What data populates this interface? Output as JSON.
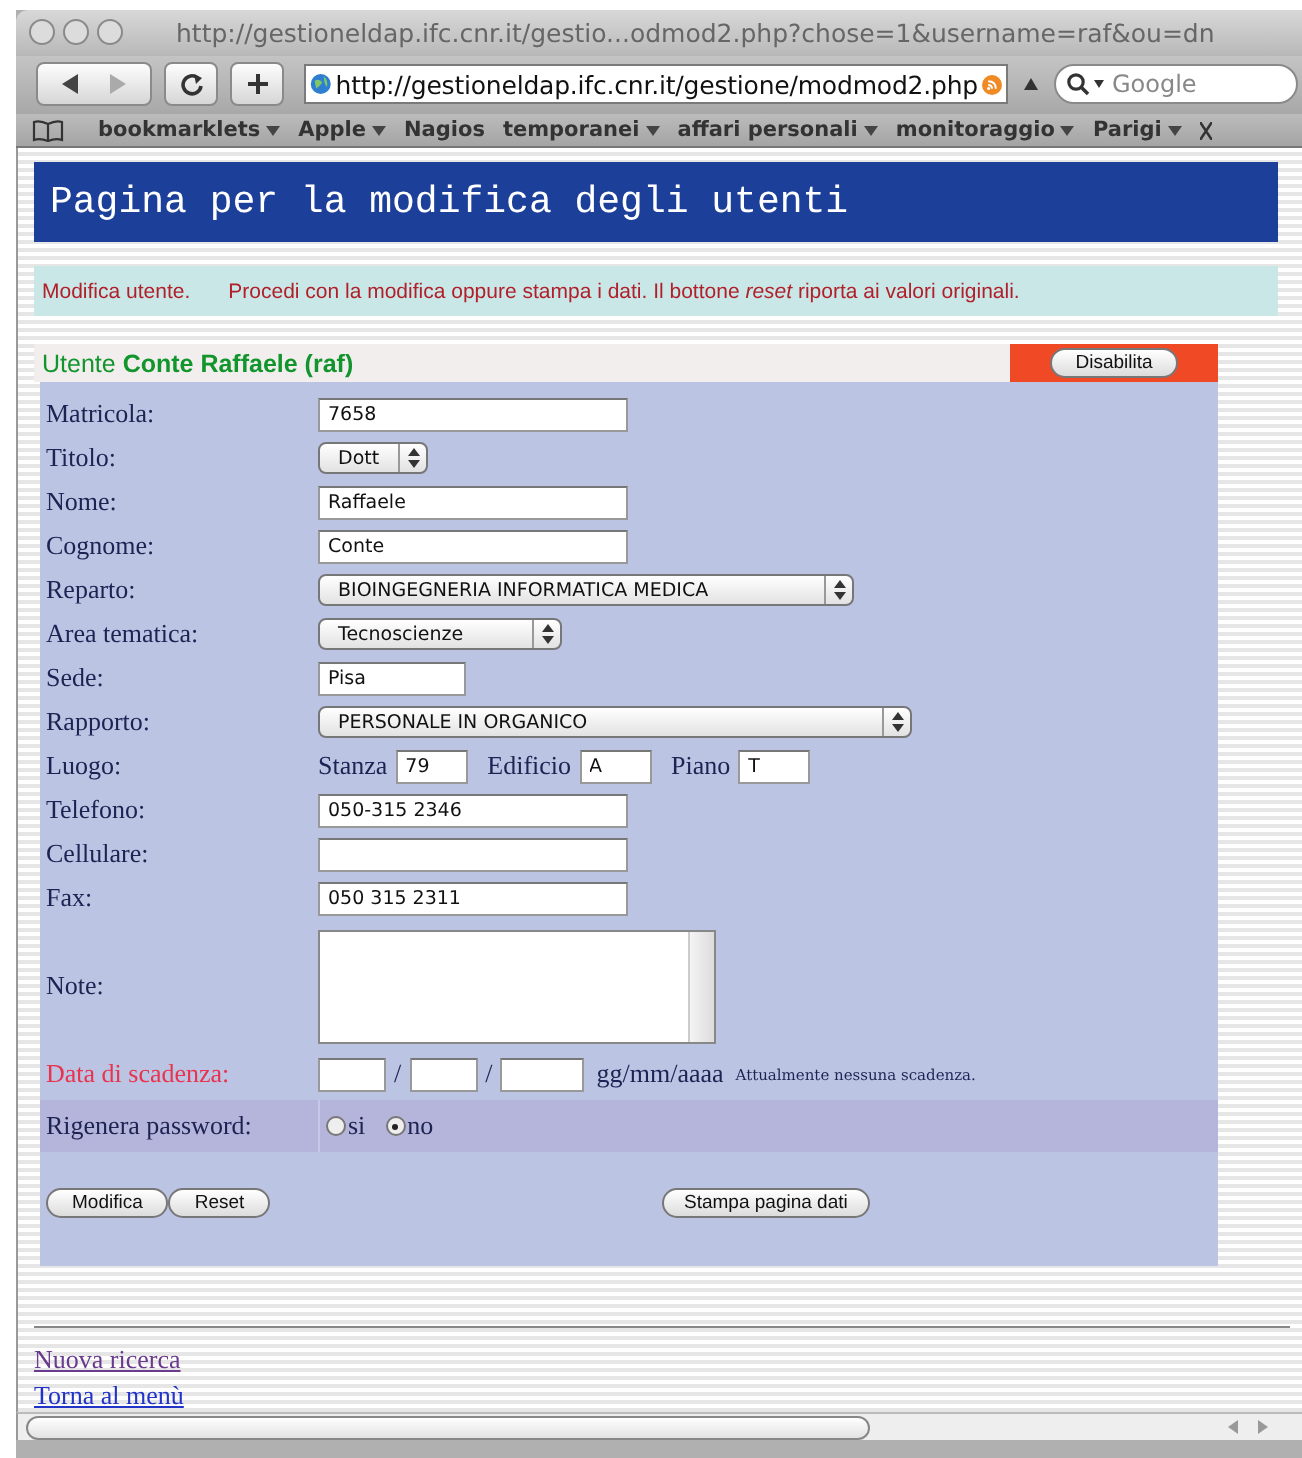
{
  "browser": {
    "title": "http://gestioneldap.ifc.cnr.it/gestio...odmod2.php?chose=1&username=raf&ou=dn",
    "url": "http://gestioneldap.ifc.cnr.it/gestione/modmod2.php",
    "search": {
      "placeholder": "Google"
    },
    "bookmarks": [
      {
        "label": "bookmarklets",
        "menu": true
      },
      {
        "label": "Apple",
        "menu": true
      },
      {
        "label": "Nagios",
        "menu": false
      },
      {
        "label": "temporanei",
        "menu": true
      },
      {
        "label": "affari personali",
        "menu": true
      },
      {
        "label": "monitoraggio",
        "menu": true
      },
      {
        "label": "Parigi",
        "menu": true
      }
    ]
  },
  "page": {
    "heading": "Pagina per la modifica degli utenti",
    "info": {
      "label": "Modifica utente.",
      "message": "Procedi con la modifica oppure stampa i dati. Il bottone *reset* riporta ai valori originali."
    },
    "user": {
      "prefix": "Utente",
      "name": "Conte Raffaele (raf)",
      "disable_button": "Disabilita"
    },
    "fields": [
      {
        "kind": "text",
        "label": "Matricola:",
        "value": "7658"
      },
      {
        "kind": "select",
        "label": "Titolo:",
        "value": "Dott"
      },
      {
        "kind": "text",
        "label": "Nome:",
        "value": "Raffaele"
      },
      {
        "kind": "text",
        "label": "Cognome:",
        "value": "Conte"
      },
      {
        "kind": "select",
        "label": "Reparto:",
        "value": "BIOINGEGNERIA INFORMATICA MEDICA"
      },
      {
        "kind": "select",
        "label": "Area tematica:",
        "value": "Tecnoscienze"
      },
      {
        "kind": "text",
        "label": "Sede:",
        "value": "Pisa"
      },
      {
        "kind": "select",
        "label": "Rapporto:",
        "value": "PERSONALE IN ORGANICO"
      },
      {
        "kind": "place",
        "label": "Luogo:",
        "parts": [
          {
            "label": "Stanza",
            "value": "79"
          },
          {
            "label": "Edificio",
            "value": "A"
          },
          {
            "label": "Piano",
            "value": "T"
          }
        ]
      },
      {
        "kind": "text",
        "label": "Telefono:",
        "value": "050-315 2346"
      },
      {
        "kind": "text",
        "label": "Cellulare:"
      },
      {
        "kind": "text",
        "label": "Fax:",
        "value": "050 315 2311"
      },
      {
        "kind": "textarea",
        "label": "Note:"
      },
      {
        "kind": "date",
        "label": "Data di scadenza:",
        "warning": true,
        "separators": [
          "/",
          "/"
        ],
        "format": "gg/mm/aaaa",
        "note": "Attualmente nessuna scadenza."
      },
      {
        "kind": "radio",
        "label": "Rigenera password:",
        "options": [
          {
            "label": "si",
            "selected": false
          },
          {
            "label": "no",
            "selected": true
          }
        ]
      }
    ],
    "buttons": [
      {
        "label": "Modifica"
      },
      {
        "label": "Reset"
      },
      {
        "label": "Stampa pagina dati"
      }
    ],
    "links": [
      {
        "label": "Nuova ricerca",
        "visited": true
      },
      {
        "label": "Torna al menù",
        "visited": false
      }
    ]
  }
}
